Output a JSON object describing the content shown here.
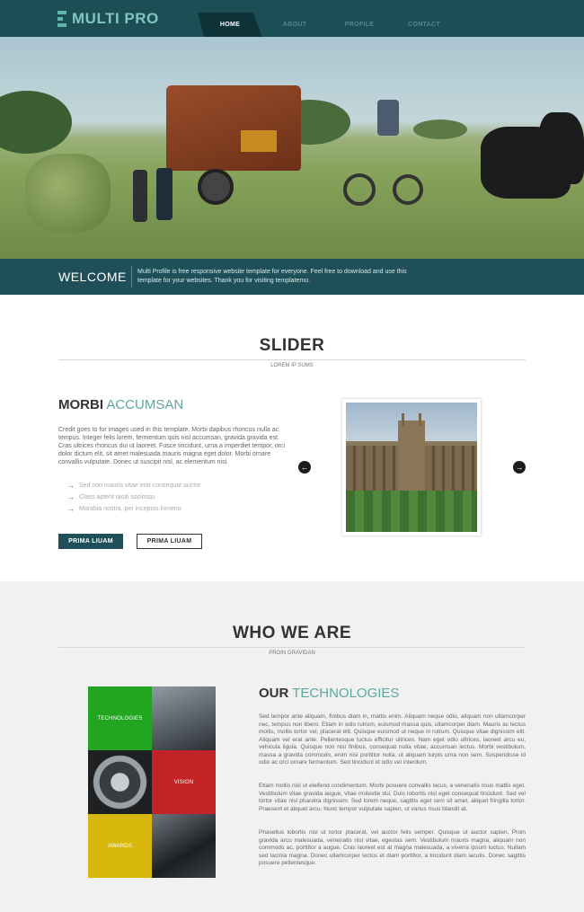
{
  "brand": {
    "name": "MULTI PRO"
  },
  "nav": {
    "items": [
      "HOME",
      "ABOUT",
      "PROFILE",
      "CONTACT"
    ],
    "active": 0
  },
  "welcome": {
    "title": "WELCOME",
    "text": "Multi Profile is free responsive website template for everyone. Feel free to download and use this template for your websites. Thank you for visiting templatemo."
  },
  "slider": {
    "title": "SLIDER",
    "subtitle": "LOREM IP SUMS",
    "heading_bold": "MORBI",
    "heading_light": "ACCUMSAN",
    "text": "Credit goes to for images used in this template. Morbi dapibus rhoncus nulla ac tempus. Integer felis lorem, fermentum quis nisl accumsan, gravida gravida est. Cras ultrices rhoncus dui ut laoreet. Fusce tincidunt, urna a imperdiet tempor, orci dolor dictum elit, sit amet malesuada mauris magna eget dolor. Morbi ornare convallis vulputate. Donec ut suscipit nisl, ac elementum nisi.",
    "bullets": [
      "Sed non mauris vitae erat consequat auctor",
      "Class aptent taciti sociosqu",
      "Morabia nostra, per inceptos himeno"
    ],
    "button_primary": "PRIMA LIUAM",
    "button_secondary": "PRIMA LIUAM",
    "prev_icon": "←",
    "next_icon": "→"
  },
  "who": {
    "title": "WHO WE ARE",
    "subtitle": "PROIN GRAVIDAN",
    "tiles": [
      "TECHNOLOGIES",
      "VISION",
      "AWARDS"
    ],
    "tile_colors": {
      "technologies": "#22a622",
      "vision": "#c22327",
      "awards": "#d8b80c"
    },
    "heading_bold": "OUR",
    "heading_light": "TECHNOLOGIES",
    "paragraphs": [
      "Sed tempor ante aliquam, finibus diam in, mattis enim. Aliquam neque odio, aliquam non ullamcorper nec, tempus non libero. Etiam in odio rutrum, euismod massa quis, ullamcorper diam. Mauris ac lectus mollis, mollis tortor vel, placerat elit. Quisque euismod ut neque in rutrum. Quisque vitae dignissim elit. Aliquam vel erat ante. Pellentesque luctus efficitur ultrices. Nam eget odio ultrices, laoreet arcu eu, vehicula ligula. Quisque non nisl finibus, consequat nulla vitae, accumsan lectus. Morbi vestibulum, massa a gravida commodo, enim nisi porttitor nulla, ut aliquam turpis urna non sem. Suspendisse id odio ac orci ornare fermentum. Sed tincidunt id odio vel interdum.",
      "Etiam mollis nisl ut eleifend condimentum. Morbi posuere convallis lacus, a venenatis risus mattis eget. Vestibulum vitae gravida augue, vitae molestie dui. Duis lobortis nisl eget consequat tincidunt. Sed vel tortor vitae nisl pharetra dignissim. Sed lorem neque, sagittis eget sem sit amet, aliquet fringilla tortor. Praesent et aliquet arcu. Nunc tempor vulputate sapien, ut varius risus blandit at.",
      "Phasellus lobortis nisl ut tortor placerat, vel auctor felis semper. Quisque ut auctor sapien. Proin gravida arcu malesuada, venenatis nisl vitae, egestas sem. Vestibulum mauris magna, aliquam non commodo ac, porttitor a augue. Cras laoreet est at magna malesuada, a viverra ipsum luctus. Nullam sed lacinia magna. Donec ullamcorper lectus et diam porttitor, a tincidunt diam iaculis. Donec sagittis posuere pellentesque."
    ]
  },
  "colors": {
    "primary": "#1f4f59",
    "accent": "#5fa6a0",
    "nav_bg": "#1c4e56"
  }
}
